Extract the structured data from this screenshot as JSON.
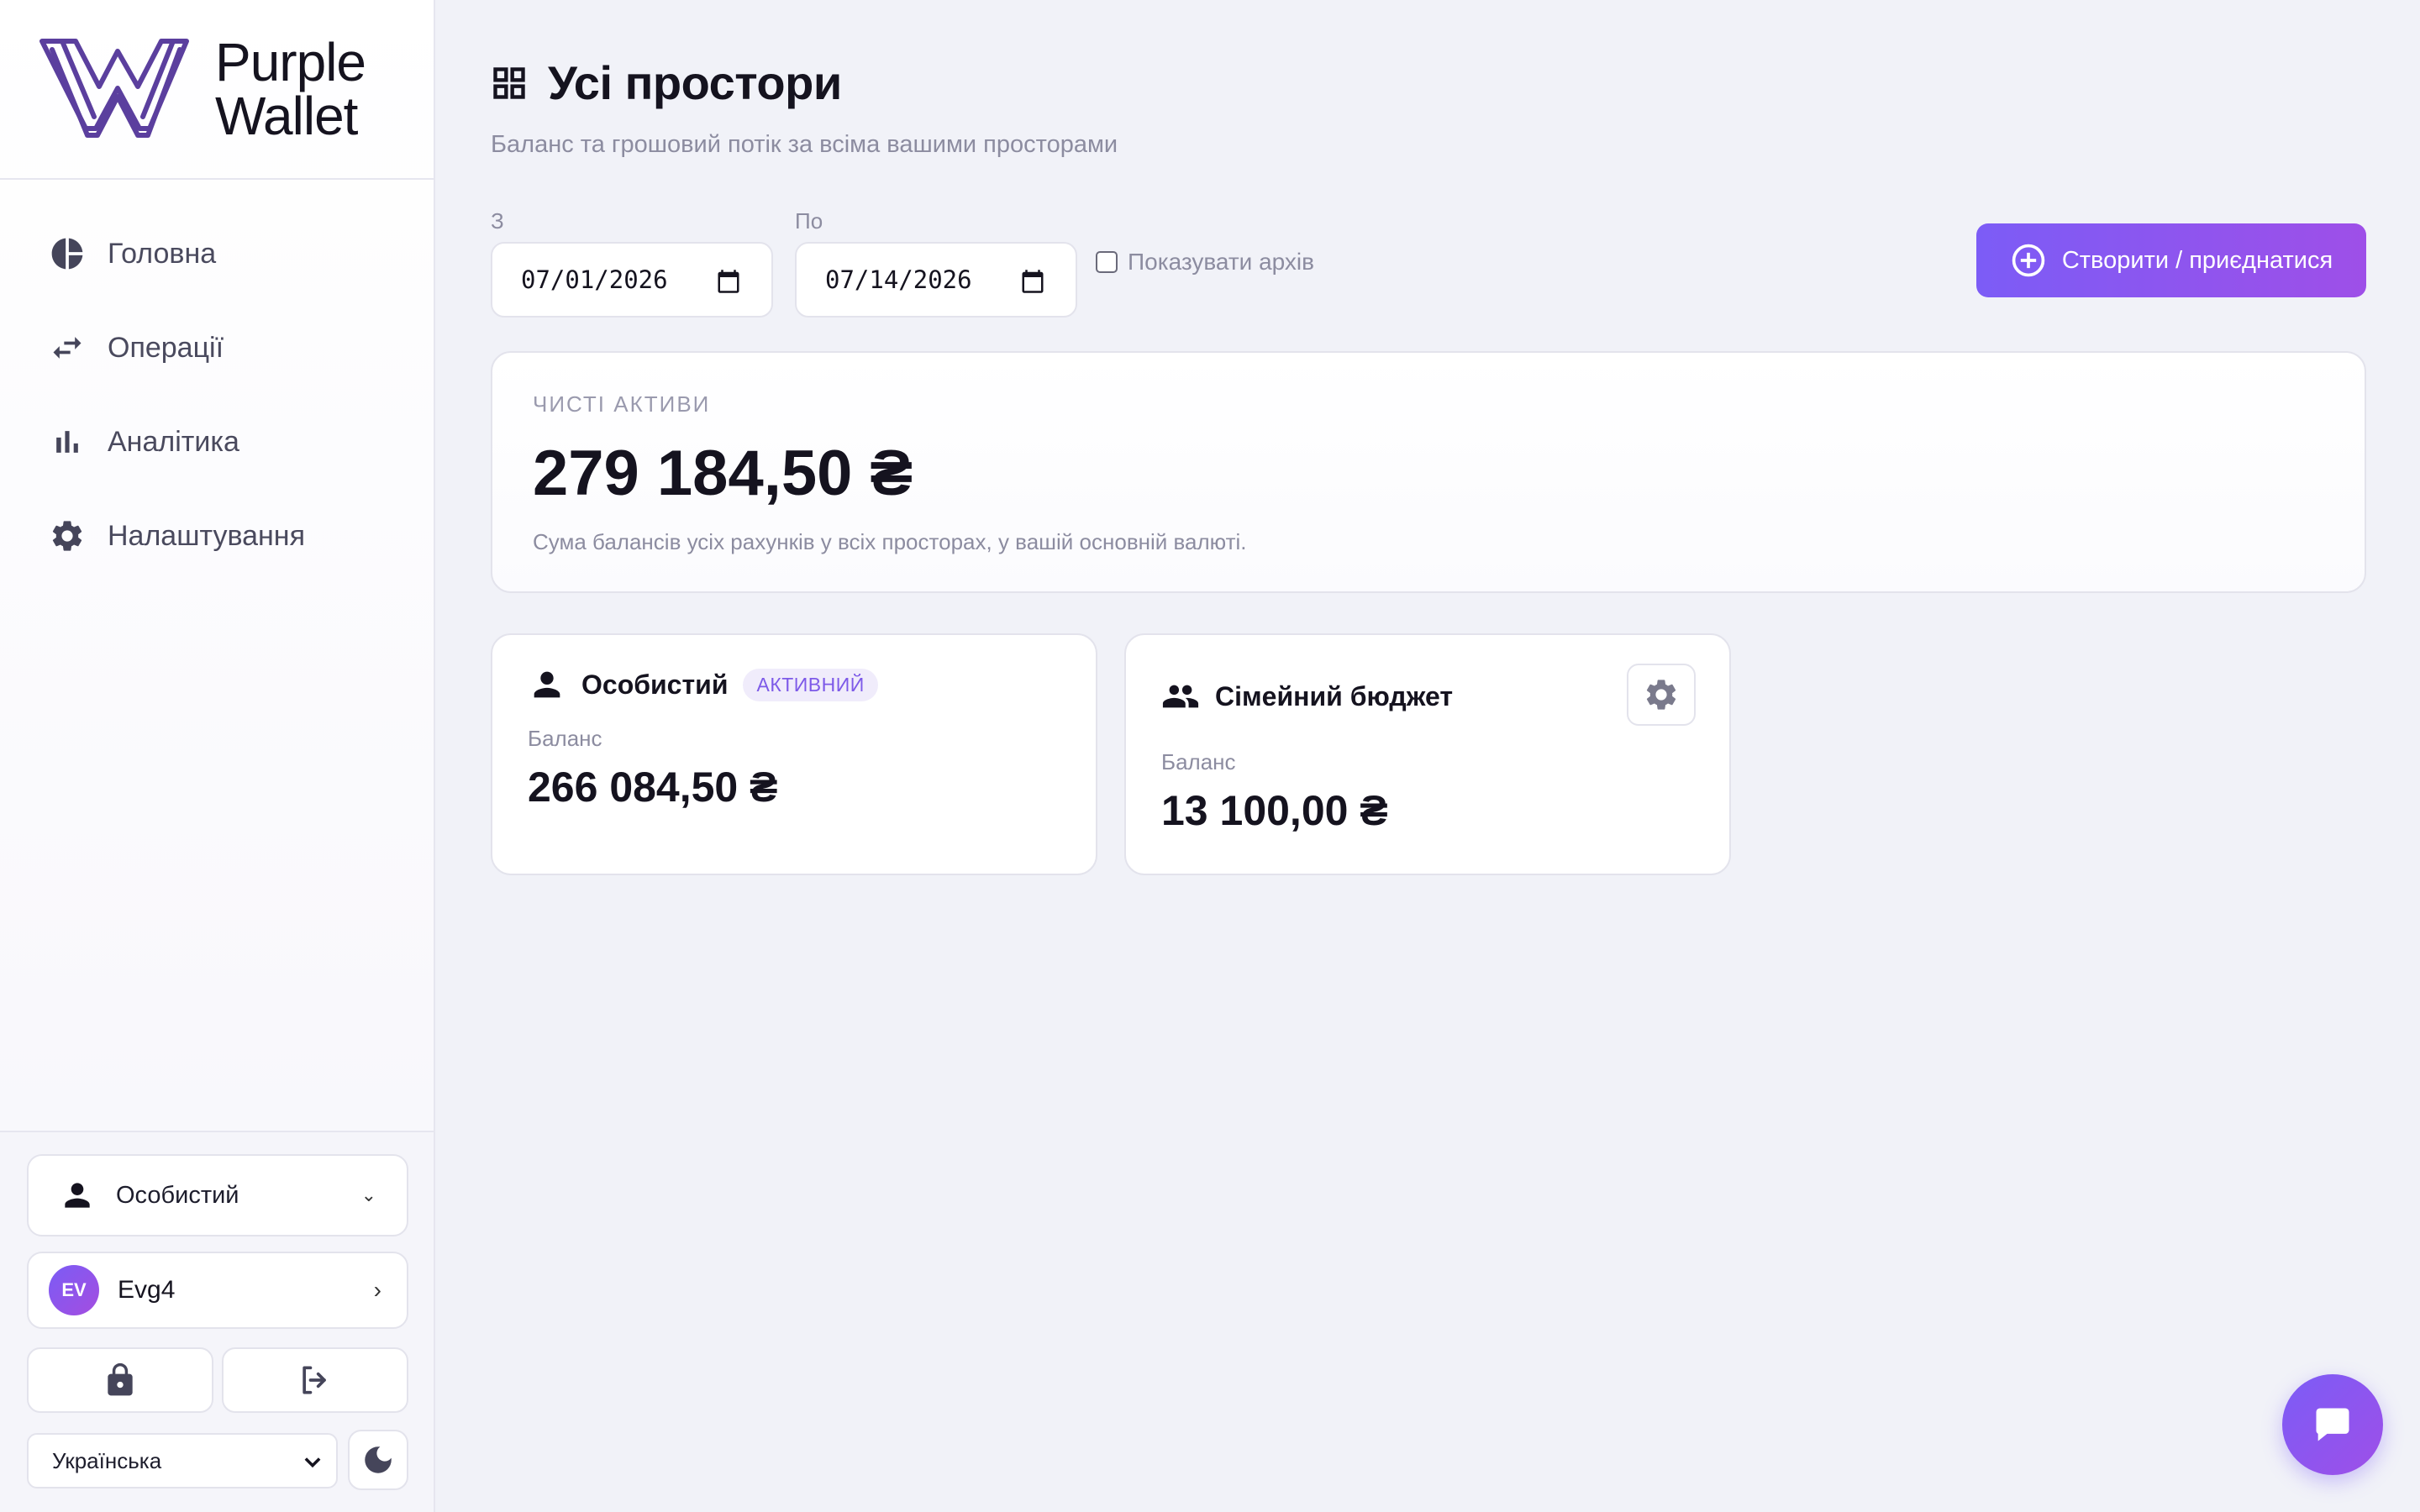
{
  "brand": {
    "line1": "Purple",
    "line2": "Wallet",
    "color": "#5b3f9e"
  },
  "nav": [
    {
      "label": "Головна",
      "icon": "pie-chart-icon"
    },
    {
      "label": "Операції",
      "icon": "swap-arrows-icon"
    },
    {
      "label": "Аналітика",
      "icon": "bar-chart-icon"
    },
    {
      "label": "Налаштування",
      "icon": "gear-icon"
    }
  ],
  "sidebar_bottom": {
    "space_select": "Особистий",
    "user": {
      "initials": "EV",
      "name": "Evg4"
    },
    "language": "Українська"
  },
  "header": {
    "title": "Усі простори",
    "subtitle": "Баланс та грошовий потік за всіма вашими просторами"
  },
  "filters": {
    "from_label": "З",
    "from_value": "07/01/2026",
    "to_label": "По",
    "to_value": "07/14/2026",
    "show_archive_label": "Показувати архів",
    "show_archive_checked": false
  },
  "create_button": "Створити / приєднатися",
  "net_assets": {
    "label": "ЧИСТІ АКТИВИ",
    "value": "279 184,50 ₴",
    "note": "Сума балансів усіх рахунків у всіх просторах, у вашій основній валюті."
  },
  "spaces": [
    {
      "name": "Особистий",
      "badge": "АКТИВНИЙ",
      "balance_label": "Баланс",
      "balance": "266 084,50 ₴",
      "icon": "person-icon"
    },
    {
      "name": "Сімейний бюджет",
      "badge": "",
      "balance_label": "Баланс",
      "balance": "13 100,00 ₴",
      "icon": "people-icon"
    }
  ],
  "colors": {
    "accent": "#7c5cf6",
    "accent_end": "#9e4fe8",
    "background": "#f1f2f8"
  }
}
